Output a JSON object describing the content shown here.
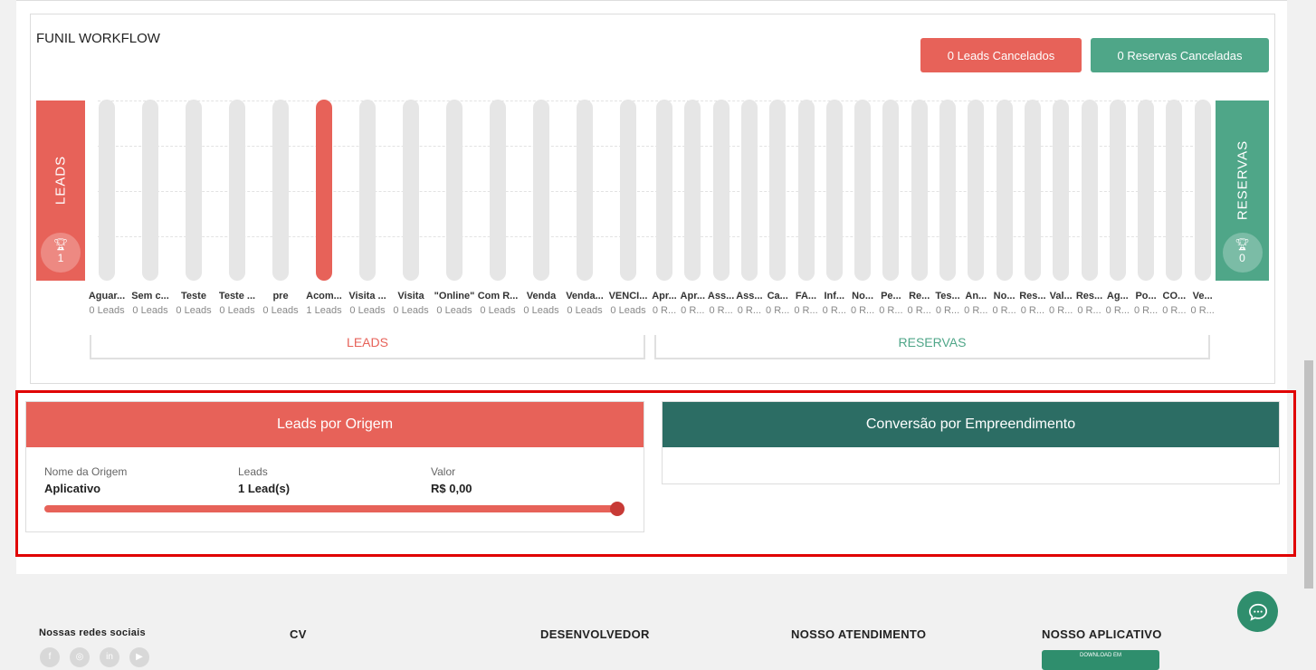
{
  "funnel": {
    "title": "FUNIL WORKFLOW",
    "btn_leads_cancelados": "0 Leads Cancelados",
    "btn_reservas_canceladas": "0 Reservas Canceladas",
    "leads_label": "LEADS",
    "leads_count": "1",
    "reservas_label": "RESERVAS",
    "reservas_count": "0",
    "bracket_leads": "LEADS",
    "bracket_reservas": "RESERVAS",
    "stages": [
      {
        "name": "Aguar...",
        "count": "0 Leads"
      },
      {
        "name": "Sem c...",
        "count": "0 Leads"
      },
      {
        "name": "Teste",
        "count": "0 Leads"
      },
      {
        "name": "Teste ...",
        "count": "0 Leads"
      },
      {
        "name": "pre",
        "count": "0 Leads"
      },
      {
        "name": "Acom...",
        "count": "1 Leads"
      },
      {
        "name": "Visita ...",
        "count": "0 Leads"
      },
      {
        "name": "Visita",
        "count": "0 Leads"
      },
      {
        "name": "\"Online\"",
        "count": "0 Leads"
      },
      {
        "name": "Com R...",
        "count": "0 Leads"
      },
      {
        "name": "Venda",
        "count": "0 Leads"
      },
      {
        "name": "Venda...",
        "count": "0 Leads"
      },
      {
        "name": "VENCI...",
        "count": "0 Leads"
      },
      {
        "name": "Apr...",
        "count": "0 R..."
      },
      {
        "name": "Apr...",
        "count": "0 R..."
      },
      {
        "name": "Ass...",
        "count": "0 R..."
      },
      {
        "name": "Ass...",
        "count": "0 R..."
      },
      {
        "name": "Ca...",
        "count": "0 R..."
      },
      {
        "name": "FA...",
        "count": "0 R..."
      },
      {
        "name": "Inf...",
        "count": "0 R..."
      },
      {
        "name": "No...",
        "count": "0 R..."
      },
      {
        "name": "Pe...",
        "count": "0 R..."
      },
      {
        "name": "Re...",
        "count": "0 R..."
      },
      {
        "name": "Tes...",
        "count": "0 R..."
      },
      {
        "name": "An...",
        "count": "0 R..."
      },
      {
        "name": "No...",
        "count": "0 R..."
      },
      {
        "name": "Res...",
        "count": "0 R..."
      },
      {
        "name": "Val...",
        "count": "0 R..."
      },
      {
        "name": "Res...",
        "count": "0 R..."
      },
      {
        "name": "Ag...",
        "count": "0 R..."
      },
      {
        "name": "Po...",
        "count": "0 R..."
      },
      {
        "name": "CO...",
        "count": "0 R..."
      },
      {
        "name": "Ve...",
        "count": "0 R..."
      }
    ]
  },
  "leads_por_origem": {
    "title": "Leads por Origem",
    "col_nome": "Nome da Origem",
    "col_leads": "Leads",
    "col_valor": "Valor",
    "row_nome": "Aplicativo",
    "row_leads": "1 Lead(s)",
    "row_valor": "R$ 0,00",
    "progress_fraction": 1.0
  },
  "conversao": {
    "title": "Conversão por Empreendimento"
  },
  "footer": {
    "social_title": "Nossas redes sociais",
    "col_cv": "CV",
    "col_dev": "DESENVOLVEDOR",
    "col_atendimento": "NOSSO ATENDIMENTO",
    "col_app": "NOSSO APLICATIVO",
    "app_btn": "DOWNLOAD EM"
  },
  "colors": {
    "red": "#e76259",
    "green": "#4fa688",
    "dark_green": "#2c6d64",
    "highlight": "#e00000"
  }
}
